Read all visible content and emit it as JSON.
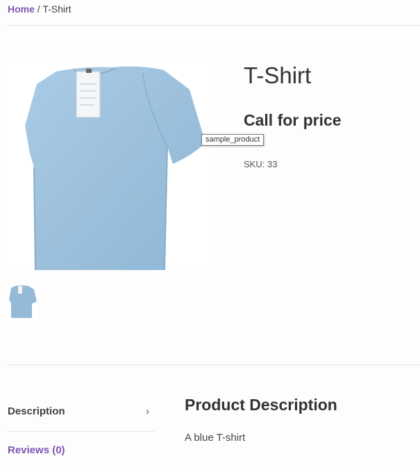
{
  "breadcrumb": {
    "home": "Home",
    "separator": " / ",
    "current": "T-Shirt"
  },
  "product": {
    "title": "T-Shirt",
    "price": "Call for price",
    "tooltip": "sample_product",
    "sku_label": "SKU:",
    "sku_value": "33",
    "image_color": "#9fc3de"
  },
  "tabs": {
    "description": "Description",
    "reviews": "Reviews (0)"
  },
  "panel": {
    "title": "Product Description",
    "text": "A blue T-shirt"
  },
  "colors": {
    "accent": "#7f54b3",
    "text": "#404040"
  },
  "icons": {
    "tab_chevron": "chevron-right-icon"
  }
}
